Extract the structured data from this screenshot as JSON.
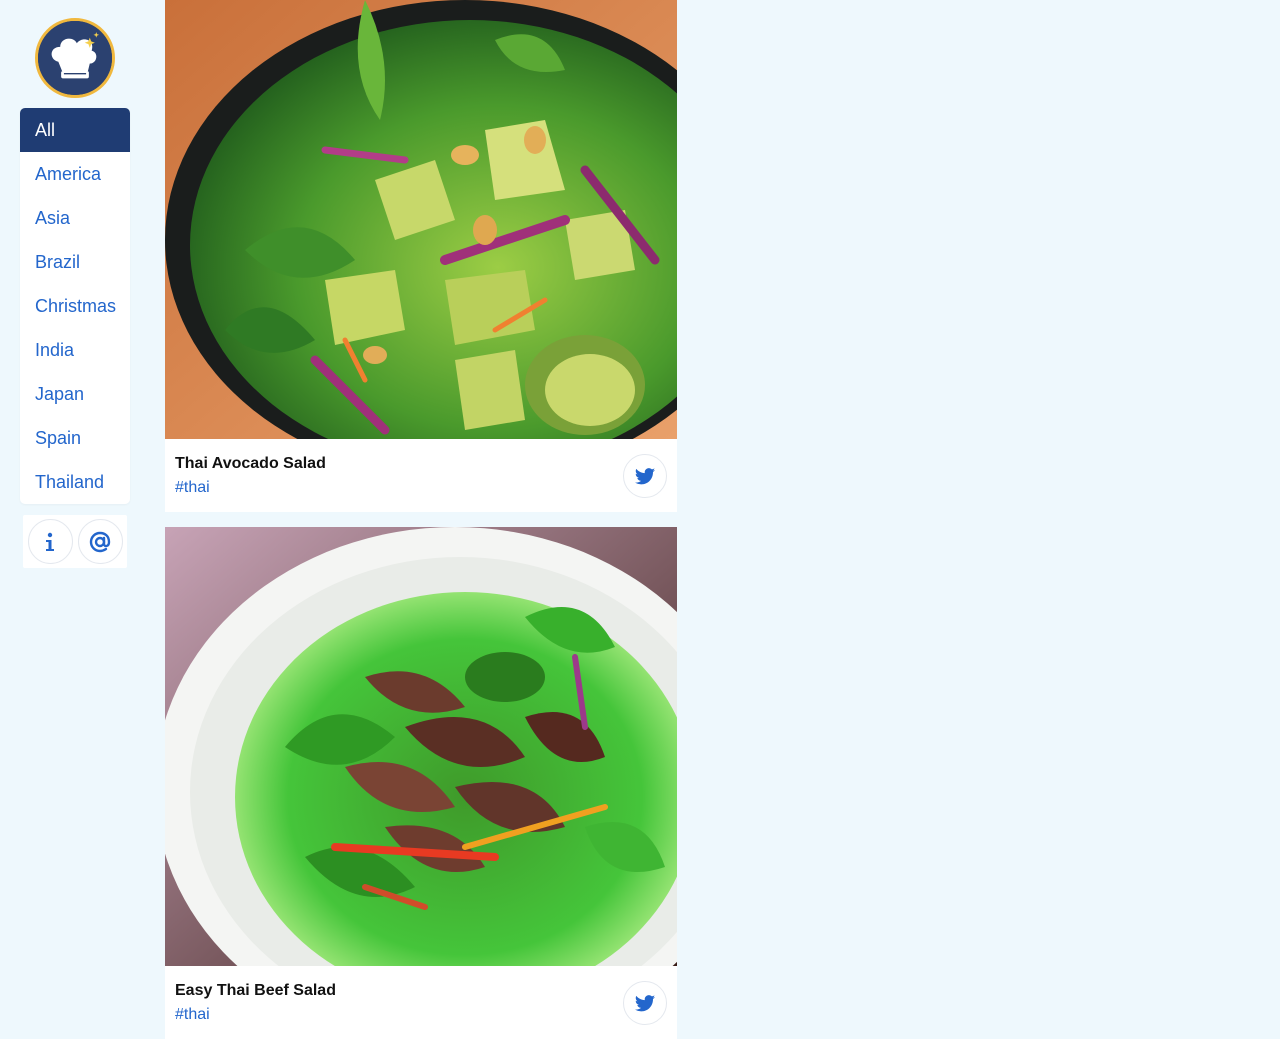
{
  "sidebar": {
    "logo_icon": "chef-hat-sparkle-icon",
    "nav": [
      {
        "label": "All",
        "active": true
      },
      {
        "label": "America"
      },
      {
        "label": "Asia"
      },
      {
        "label": "Brazil"
      },
      {
        "label": "Christmas"
      },
      {
        "label": "India"
      },
      {
        "label": "Japan"
      },
      {
        "label": "Spain"
      },
      {
        "label": "Thailand"
      }
    ],
    "buttons": [
      {
        "icon": "info-icon"
      },
      {
        "icon": "at-sign-icon"
      }
    ]
  },
  "recipes": [
    {
      "title": "Thai Avocado Salad",
      "tag": "#thai",
      "share_icon": "twitter-icon"
    },
    {
      "title": "Easy Thai Beef Salad",
      "tag": "#thai",
      "share_icon": "twitter-icon"
    }
  ],
  "colors": {
    "background": "#eef8fd",
    "accent": "#2366cc",
    "nav_active": "#1f3c73",
    "logo_ring": "#f0b83e"
  }
}
